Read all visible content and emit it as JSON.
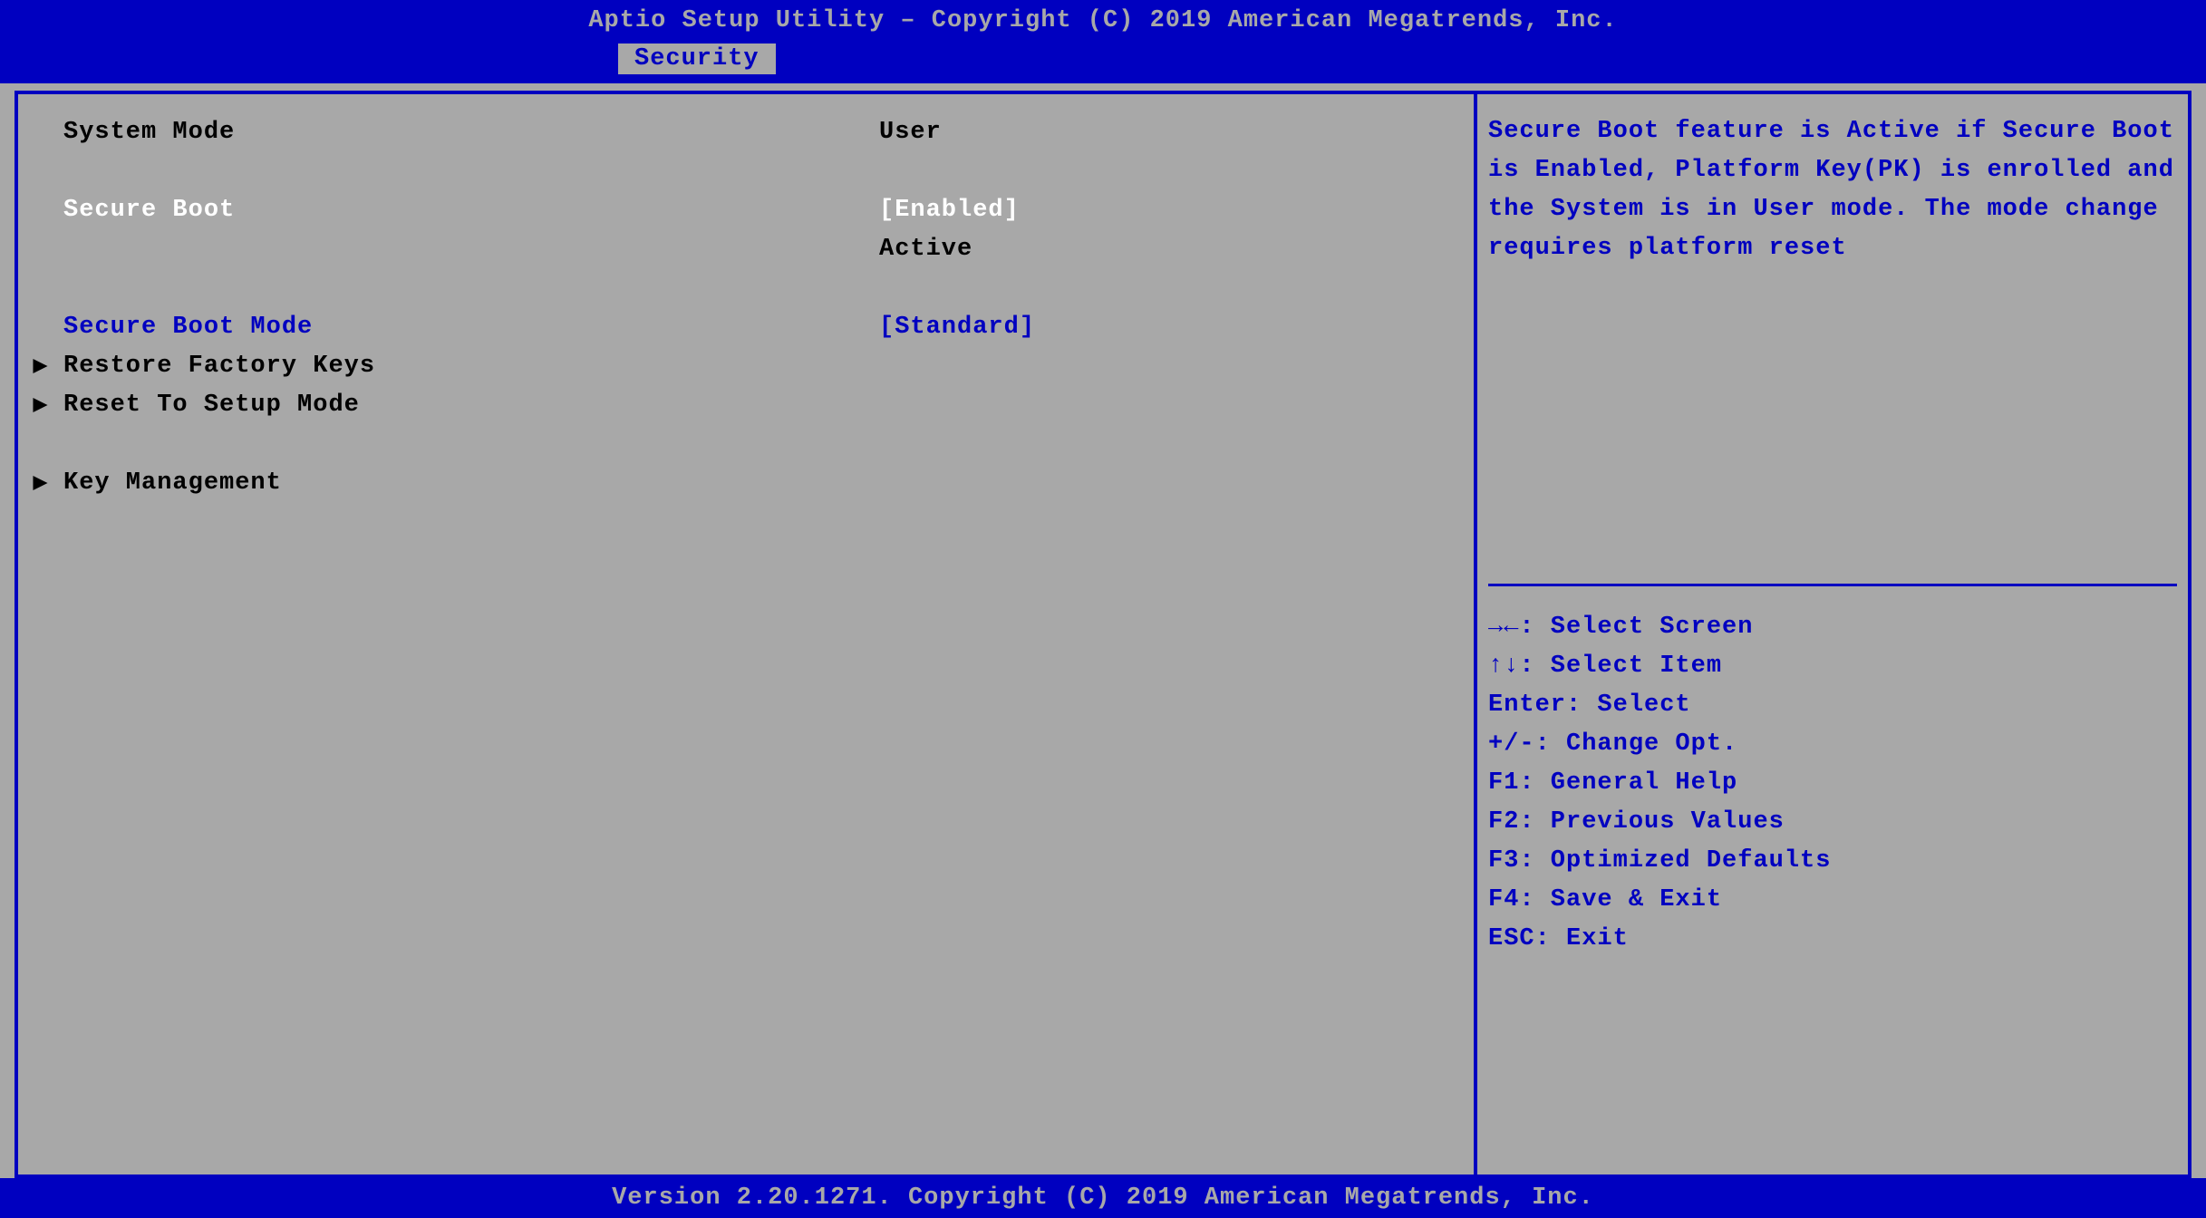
{
  "header": {
    "title": "Aptio Setup Utility – Copyright (C) 2019 American Megatrends, Inc.",
    "tab": "Security"
  },
  "settings": {
    "system_mode": {
      "label": "System Mode",
      "value": "User"
    },
    "secure_boot": {
      "label": "Secure Boot",
      "value": "[Enabled]",
      "status": "Active"
    },
    "secure_boot_mode": {
      "label": "Secure Boot Mode",
      "value": "[Standard]"
    },
    "restore_factory_keys": {
      "label": "Restore Factory Keys"
    },
    "reset_to_setup_mode": {
      "label": "Reset To Setup Mode"
    },
    "key_management": {
      "label": "Key Management"
    }
  },
  "help": {
    "text": "Secure Boot feature is Active if Secure Boot is Enabled, Platform Key(PK) is enrolled and the System is in User mode. The mode change requires platform reset"
  },
  "hotkeys": {
    "select_screen": "→←: Select Screen",
    "select_item": "↑↓: Select Item",
    "select": "Enter: Select",
    "change_opt": "+/-: Change Opt.",
    "general_help": "F1: General Help",
    "previous_values": "F2: Previous Values",
    "optimized_defaults": "F3: Optimized Defaults",
    "save_exit": "F4: Save & Exit",
    "exit": "ESC: Exit"
  },
  "footer": {
    "text": "Version 2.20.1271. Copyright (C) 2019 American Megatrends, Inc."
  }
}
